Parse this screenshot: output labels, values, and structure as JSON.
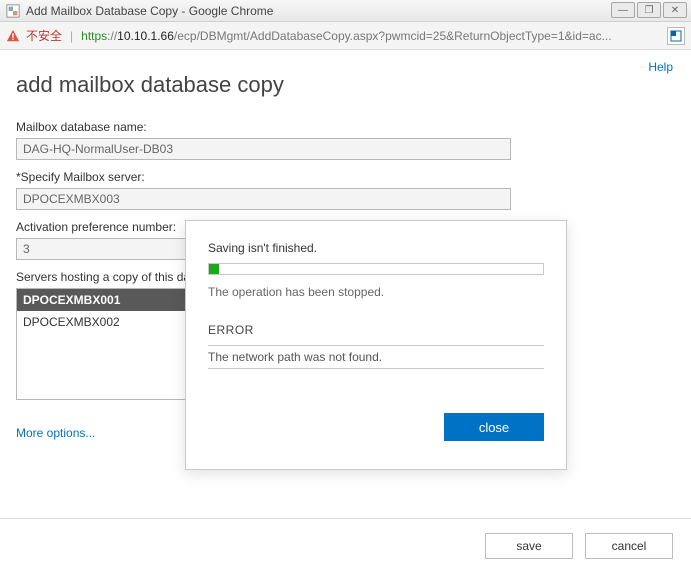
{
  "window": {
    "title": "Add Mailbox Database Copy - Google Chrome",
    "buttons": {
      "min": "—",
      "max": "❐",
      "close": "✕"
    }
  },
  "address": {
    "warn_text": "不安全",
    "https": "https",
    "sep": "://",
    "host": "10.10.1.66",
    "path": "/ecp/DBMgmt/AddDatabaseCopy.aspx?pwmcid=25&ReturnObjectType=1&id=ac...",
    "ext_label": "o"
  },
  "page": {
    "help": "Help",
    "title": "add mailbox database copy",
    "db_label": "Mailbox database name:",
    "db_value": "DAG-HQ-NormalUser-DB03",
    "server_label": "*Specify Mailbox server:",
    "server_value": "DPOCEXMBX003",
    "activation_label": "Activation preference number:",
    "activation_value": "3",
    "hosting_label": "Servers hosting a copy of this database:",
    "hosting_items": [
      "DPOCEXMBX001",
      "DPOCEXMBX002"
    ],
    "more_link": "More options...",
    "save": "save",
    "cancel": "cancel"
  },
  "modal": {
    "status": "Saving isn't finished.",
    "stopped": "The operation has been stopped.",
    "error_label": "ERROR",
    "error_text": "The network path was not found.",
    "close": "close",
    "progress_percent": 3
  }
}
